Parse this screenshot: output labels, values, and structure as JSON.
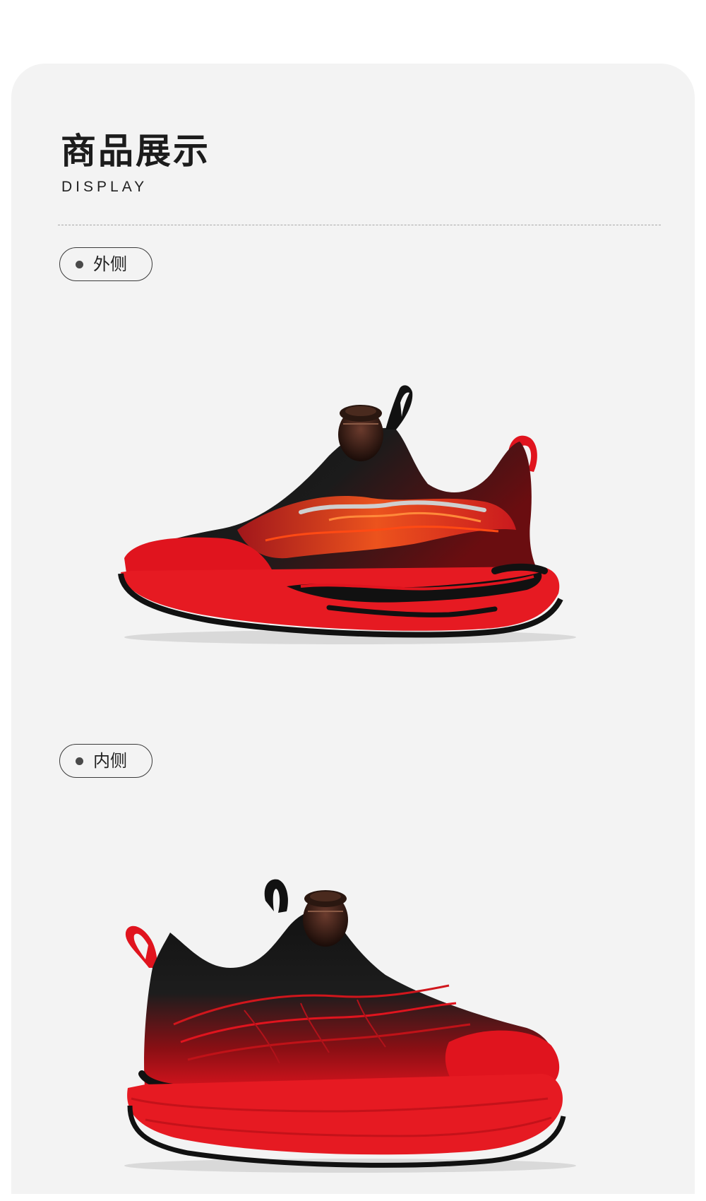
{
  "section": {
    "title": "商品展示",
    "subtitle": "DISPLAY"
  },
  "views": [
    {
      "label": "外侧",
      "image": "shoe-lateral-view"
    },
    {
      "label": "内侧",
      "image": "shoe-medial-view"
    }
  ],
  "colors": {
    "background": "#f3f3f3",
    "shoe_red": "#e0141e",
    "shoe_black": "#111111",
    "accent_orange": "#ff5a1e"
  }
}
